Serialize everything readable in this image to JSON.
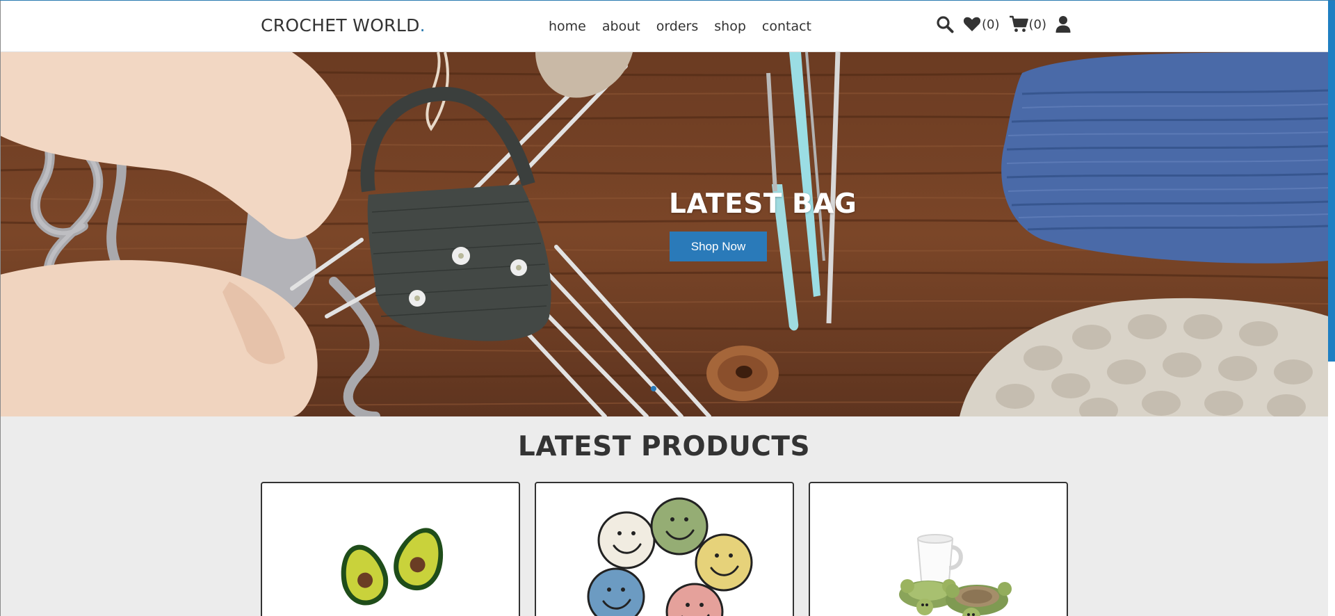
{
  "header": {
    "logo_text": "CROCHET WORLD",
    "logo_dot": ".",
    "nav": [
      {
        "label": "home"
      },
      {
        "label": "about"
      },
      {
        "label": "orders"
      },
      {
        "label": "shop"
      },
      {
        "label": "contact"
      }
    ],
    "wishlist_count": "(0)",
    "cart_count": "(0)",
    "icons": [
      "search-icon",
      "heart-icon",
      "cart-icon",
      "user-icon"
    ]
  },
  "hero": {
    "title": "LATEST BAG",
    "button_label": "Shop Now",
    "slide_dots": 1,
    "active_dot": 0
  },
  "products": {
    "title": "LATEST PRODUCTS",
    "items": [
      {
        "image": "avocado-crochet-coasters"
      },
      {
        "image": "smiley-crochet-coasters"
      },
      {
        "image": "turtle-crochet-coasters-with-mug"
      }
    ]
  },
  "colors": {
    "accent": "#2a7ab9",
    "text": "#333333",
    "background": "#ececec"
  }
}
